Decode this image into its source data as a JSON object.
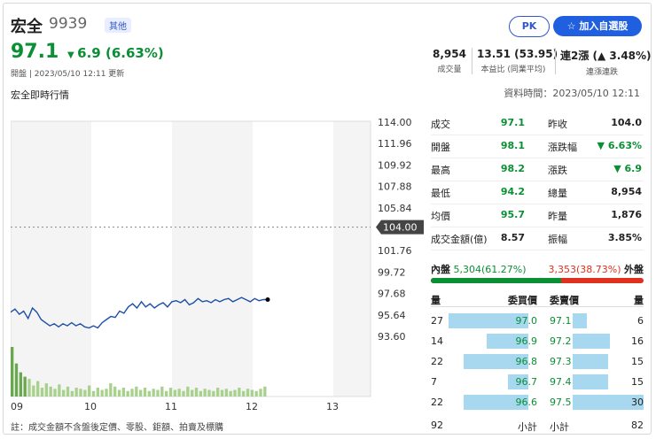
{
  "header": {
    "name": "宏全",
    "code": "9939",
    "tag": "其他",
    "price": "97.1",
    "change": "6.9 (6.63%)",
    "meta": "開盤 | 2023/05/10 12:11 更新",
    "pk_label": "PK",
    "favorite_label": "加入自選股"
  },
  "summary": [
    {
      "value": "8,954",
      "label": "成交量"
    },
    {
      "value": "13.51 (53.95)",
      "label": "本益比 (同業平均)"
    },
    {
      "value": "連2漲 (▲ 3.48%)",
      "label": "連漲連跌"
    }
  ],
  "subtitle": "宏全即時行情",
  "as_of": "資料時間：2023/05/10 12:11",
  "quote_left": [
    {
      "label": "成交",
      "value": "97.1"
    },
    {
      "label": "開盤",
      "value": "98.1"
    },
    {
      "label": "最高",
      "value": "98.2"
    },
    {
      "label": "最低",
      "value": "94.2"
    },
    {
      "label": "均價",
      "value": "95.7"
    },
    {
      "label": "成交金額(億)",
      "value": "8.57"
    }
  ],
  "quote_right": [
    {
      "label": "昨收",
      "value": "104.0"
    },
    {
      "label": "漲跌幅",
      "value": "▼ 6.63%"
    },
    {
      "label": "漲跌",
      "value": "▼ 6.9"
    },
    {
      "label": "總量",
      "value": "8,954"
    },
    {
      "label": "昨量",
      "value": "1,876"
    },
    {
      "label": "振幅",
      "value": "3.85%"
    }
  ],
  "inner_outer": {
    "inner_label": "內盤",
    "inner_value": "5,304(61.27%)",
    "outer_value": "3,353(38.73%)",
    "outer_label": "外盤",
    "inner_ratio": 0.6127
  },
  "order_book": {
    "headers": [
      "量",
      "委買價",
      "委賣價",
      "量"
    ],
    "bids": [
      {
        "qty": "27",
        "price": "97.0",
        "fill": 0.9
      },
      {
        "qty": "14",
        "price": "96.9",
        "fill": 0.47
      },
      {
        "qty": "22",
        "price": "96.8",
        "fill": 0.73
      },
      {
        "qty": "7",
        "price": "96.7",
        "fill": 0.23
      },
      {
        "qty": "22",
        "price": "96.6",
        "fill": 0.73
      }
    ],
    "asks": [
      {
        "price": "97.1",
        "qty": "6",
        "fill": 0.2
      },
      {
        "price": "97.2",
        "qty": "16",
        "fill": 0.53
      },
      {
        "price": "97.3",
        "qty": "15",
        "fill": 0.5
      },
      {
        "price": "97.4",
        "qty": "15",
        "fill": 0.5
      },
      {
        "price": "97.5",
        "qty": "30",
        "fill": 1.0
      }
    ],
    "bid_total": "92",
    "bid_total_label": "小計",
    "ask_total_label": "小計",
    "ask_total": "82"
  },
  "footnote": "註：成交金額不含盤後定價、零股、鉅額、拍賣及標購",
  "chart_data": {
    "type": "line",
    "y_ticks": [
      "114.00",
      "111.96",
      "109.92",
      "107.88",
      "105.84",
      "104.00",
      "101.76",
      "99.72",
      "97.68",
      "95.64",
      "93.60"
    ],
    "ylim": [
      93.6,
      114.0
    ],
    "reference": "104.00",
    "x_ticks": [
      "09",
      "10",
      "11",
      "12",
      "13"
    ],
    "price_series": [
      95.9,
      96.2,
      95.7,
      96.0,
      95.3,
      96.3,
      95.9,
      95.2,
      94.9,
      94.6,
      94.8,
      94.5,
      94.8,
      94.6,
      94.9,
      94.6,
      94.8,
      94.5,
      94.4,
      94.6,
      94.4,
      94.9,
      95.2,
      95.5,
      95.4,
      96.0,
      95.8,
      96.4,
      96.7,
      96.3,
      96.9,
      96.4,
      96.7,
      96.3,
      96.6,
      96.8,
      96.4,
      96.9,
      97.0,
      96.8,
      97.1,
      96.6,
      96.8,
      97.2,
      96.9,
      97.0,
      96.8,
      97.1,
      96.9,
      97.1,
      97.2,
      96.9,
      97.1,
      97.3,
      97.1,
      96.9,
      97.2,
      97.0,
      97.1,
      97.1
    ],
    "volume_series": [
      45,
      30,
      22,
      18,
      16,
      10,
      14,
      8,
      12,
      9,
      7,
      11,
      6,
      9,
      5,
      8,
      7,
      6,
      10,
      5,
      8,
      6,
      7,
      12,
      9,
      6,
      8,
      5,
      7,
      9,
      6,
      8,
      5,
      7,
      6,
      9,
      5,
      8,
      6,
      7,
      5,
      9,
      6,
      8,
      5,
      7,
      6,
      5,
      8,
      6,
      7,
      5,
      6,
      8,
      5,
      7,
      6,
      5,
      7,
      9
    ]
  }
}
